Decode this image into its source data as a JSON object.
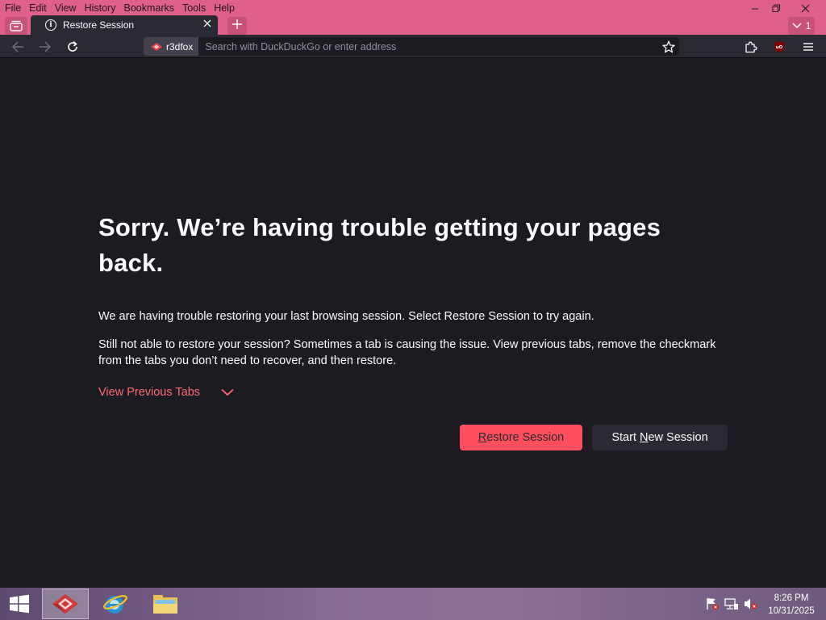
{
  "menu": {
    "items": [
      {
        "label": "File"
      },
      {
        "label": "Edit"
      },
      {
        "label": "View"
      },
      {
        "label": "History"
      },
      {
        "label": "Bookmarks"
      },
      {
        "label": "Tools"
      },
      {
        "label": "Help"
      }
    ]
  },
  "tabs": {
    "active_title": "Restore Session",
    "count": "1"
  },
  "urlbar": {
    "identity_label": "r3dfox",
    "placeholder": "Search with DuckDuckGo or enter address"
  },
  "page": {
    "headline": "Sorry. We’re having trouble getting your pages back.",
    "para1": "We are having trouble restoring your last browsing session. Select Restore Session to try again.",
    "para2": "Still not able to restore your session? Sometimes a tab is causing the issue. View previous tabs, remove the checkmark from the tabs you don’t need to recover, and then restore.",
    "view_previous_tabs": "View Previous Tabs",
    "restore_btn": {
      "accel": "R",
      "rest": "estore Session"
    },
    "new_session_btn": {
      "pre": "Start ",
      "accel": "N",
      "rest": "ew Session"
    }
  },
  "taskbar": {
    "apps": [
      "r3dfox",
      "Internet Explorer",
      "File Explorer"
    ],
    "clock_time": "8:26 PM",
    "clock_date": "10/31/2025"
  },
  "colors": {
    "titlebar": "#e05f8b",
    "toolbar": "#2b2a33",
    "content_bg": "#1c1b22",
    "accent": "#ff4f5e",
    "link": "#ff6a75"
  }
}
